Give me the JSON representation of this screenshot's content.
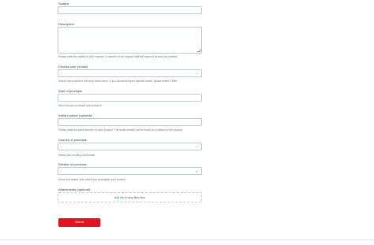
{
  "form": {
    "subject": {
      "label": "Subject",
      "value": ""
    },
    "description": {
      "label": "Description",
      "value": "",
      "hint": "Please enter the details of your request. A member of our support staff will respond as soon as possible."
    },
    "product": {
      "label": "Choose your product",
      "value": "-",
      "hint": "Select your product in the drop down menu. If you cannot find your specific model, please select \"Other\"."
    },
    "purchase_date": {
      "label": "Date of purchase",
      "value": "",
      "hint": "When did you purchase your product?"
    },
    "serial": {
      "label": "Serial number (optional)",
      "value": "",
      "hint": "Please enter the serial number for your product. The serial number can be found on a sticker on the product."
    },
    "country": {
      "label": "Country of purchase",
      "value": "-",
      "hint": "Select your country of purchase"
    },
    "retailer": {
      "label": "Retailer of purchase",
      "value": "-",
      "hint": "Select the retailer from where you purchased your product"
    },
    "attachments": {
      "label": "Attachments (optional)",
      "link_text": "Add file",
      "rest_text": " or drop files here"
    },
    "submit_label": "Submit"
  },
  "colors": {
    "submit_bg": "#e3121e",
    "link": "#1f73b7",
    "border": "#c2c8cc"
  },
  "icons": {
    "select_chevron": "chevron-down-icon",
    "textarea_resize": "resize-handle-icon"
  }
}
